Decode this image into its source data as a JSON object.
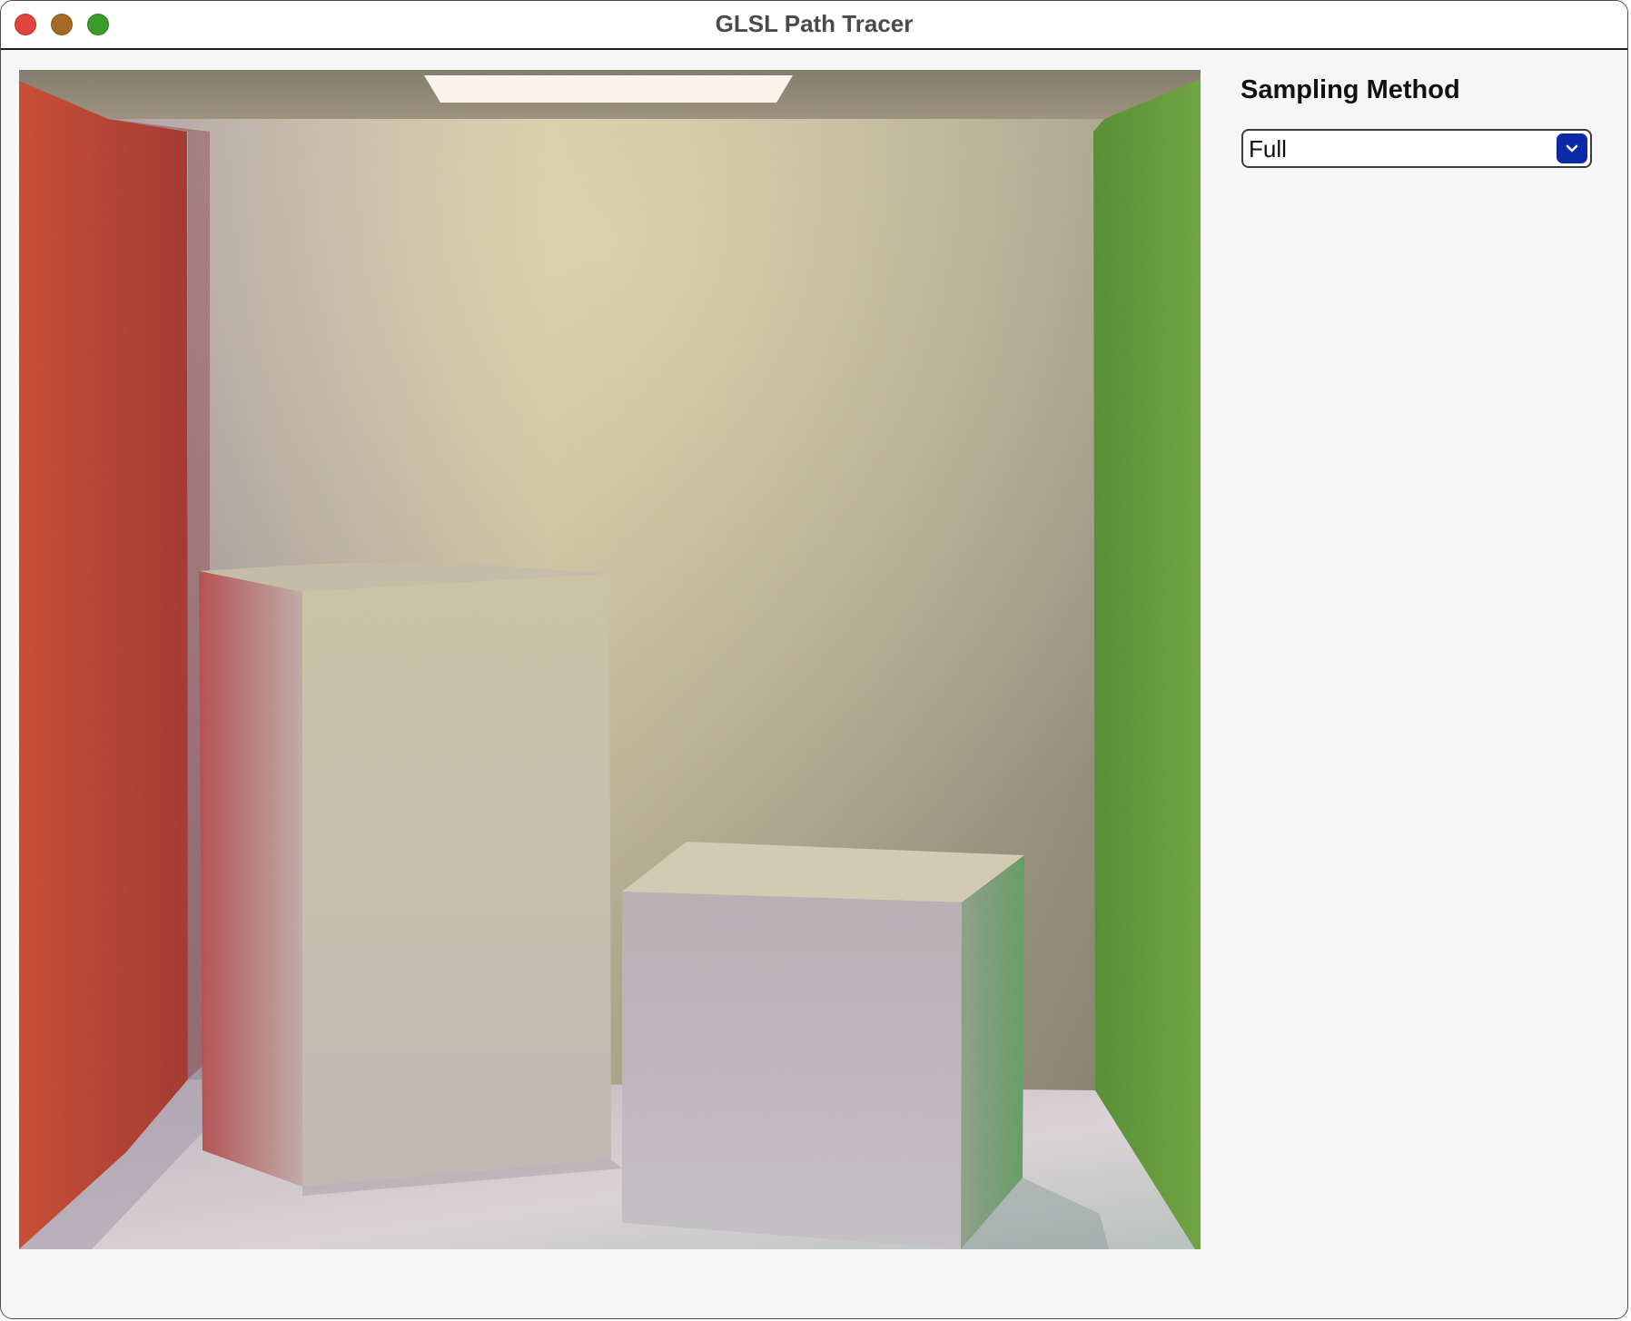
{
  "window": {
    "title": "GLSL Path Tracer"
  },
  "traffic_lights": {
    "close_color": "#e0443a",
    "minimize_color": "#a56a27",
    "maximize_color": "#3d9a2b"
  },
  "render_view": {
    "scene": "cornell-box",
    "colors": {
      "left_wall": "#c43a22",
      "right_wall": "#5f9a30",
      "back_wall": "#a89f85",
      "floor": "#d6cfd2",
      "light": "#fffaf2"
    }
  },
  "settings_panel": {
    "heading": "Sampling Method",
    "sampling_method": {
      "selected": "Full",
      "icon": "chevron-down-icon",
      "accent_color": "#0a2aa6"
    }
  }
}
